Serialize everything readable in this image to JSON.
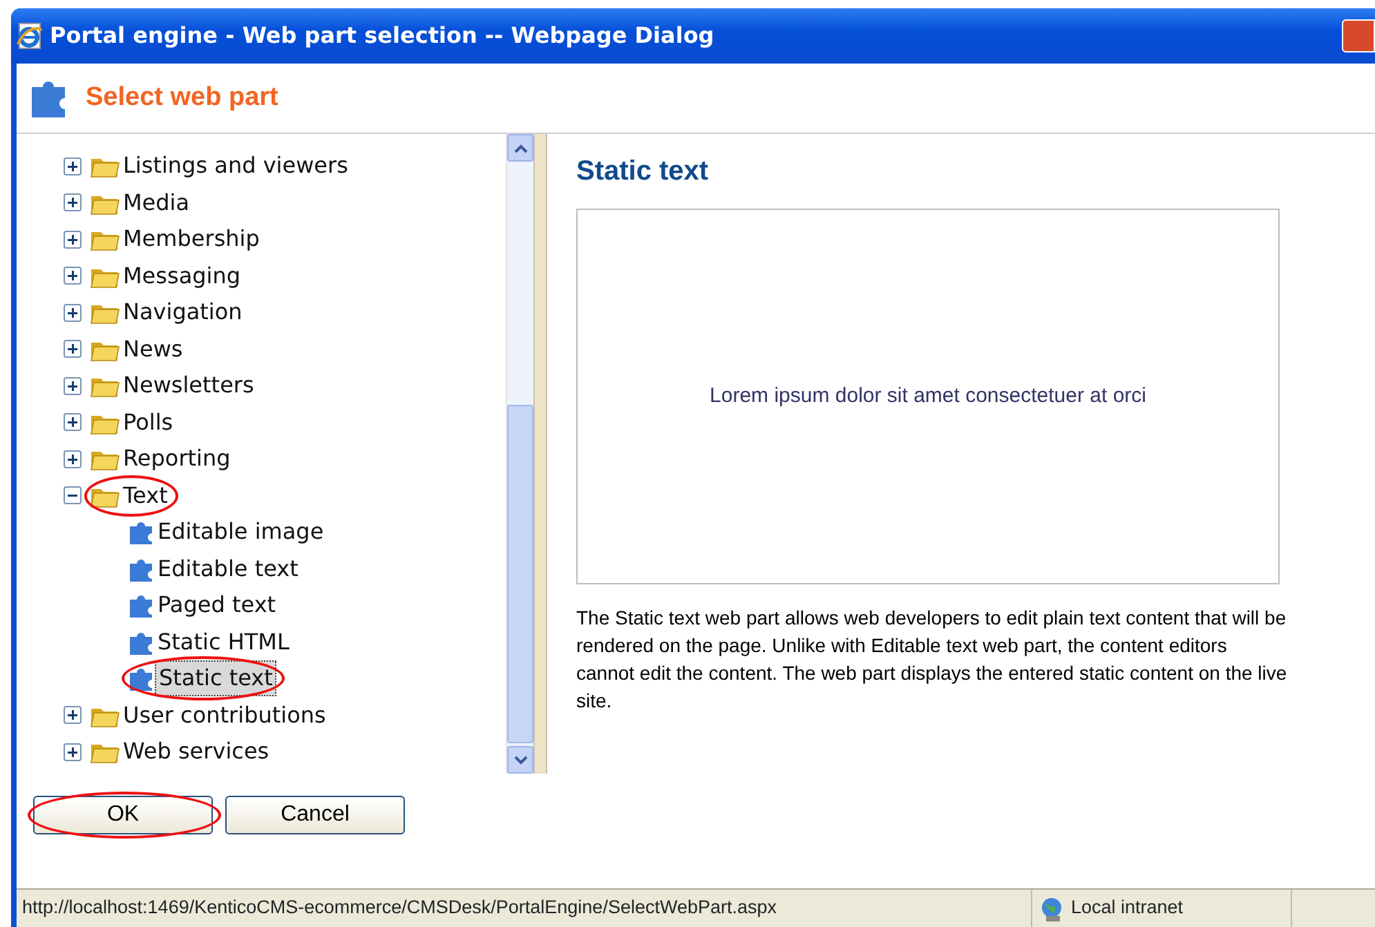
{
  "window": {
    "title": "Portal engine - Web part selection -- Webpage Dialog"
  },
  "header": {
    "title": "Select web part"
  },
  "tree": [
    {
      "label": "Listings and viewers",
      "expanded": false,
      "circled": false
    },
    {
      "label": "Media",
      "expanded": false,
      "circled": false
    },
    {
      "label": "Membership",
      "expanded": false,
      "circled": false
    },
    {
      "label": "Messaging",
      "expanded": false,
      "circled": false
    },
    {
      "label": "Navigation",
      "expanded": false,
      "circled": false
    },
    {
      "label": "News",
      "expanded": false,
      "circled": false
    },
    {
      "label": "Newsletters",
      "expanded": false,
      "circled": false
    },
    {
      "label": "Polls",
      "expanded": false,
      "circled": false
    },
    {
      "label": "Reporting",
      "expanded": false,
      "circled": false
    },
    {
      "label": "Text",
      "expanded": true,
      "circled": true,
      "children": [
        {
          "label": "Editable image",
          "selected": false,
          "circled": false
        },
        {
          "label": "Editable text",
          "selected": false,
          "circled": false
        },
        {
          "label": "Paged text",
          "selected": false,
          "circled": false
        },
        {
          "label": "Static HTML",
          "selected": false,
          "circled": false
        },
        {
          "label": "Static text",
          "selected": true,
          "circled": true
        }
      ]
    },
    {
      "label": "User contributions",
      "expanded": false,
      "circled": false
    },
    {
      "label": "Web services",
      "expanded": false,
      "circled": false
    }
  ],
  "detail": {
    "title": "Static text",
    "preview": "Lorem ipsum dolor sit amet consectetuer at orci",
    "description": "The Static text web part allows web developers to edit plain text content that will be rendered on the page. Unlike with Editable text web part, the content editors cannot edit the content. The web part displays the entered static content on the live site."
  },
  "buttons": [
    {
      "label": "OK",
      "circled": true
    },
    {
      "label": "Cancel",
      "circled": false
    }
  ],
  "status_bar": {
    "url": "http://localhost:1469/KenticoCMS-ecommerce/CMSDesk/PortalEngine/SelectWebPart.aspx",
    "zone": "Local intranet"
  }
}
